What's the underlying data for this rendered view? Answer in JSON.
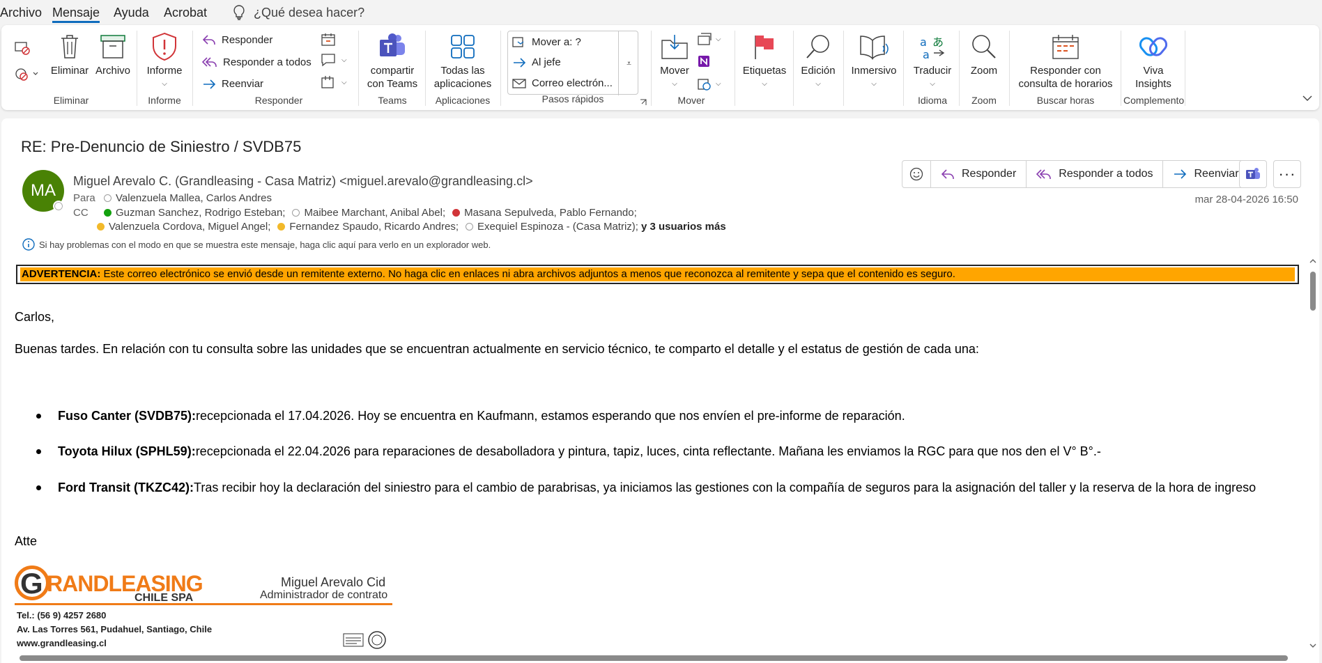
{
  "menu": {
    "tabs": [
      "Archivo",
      "Mensaje",
      "Ayuda",
      "Acrobat"
    ],
    "tell_me": "¿Qué desea hacer?"
  },
  "ribbon": {
    "eliminar": {
      "delete": "Eliminar",
      "archive": "Archivo",
      "label": "Eliminar"
    },
    "informe": {
      "button": "Informe",
      "label": "Informe"
    },
    "responder": {
      "reply": "Responder",
      "reply_all": "Responder a todos",
      "forward": "Reenviar",
      "label": "Responder"
    },
    "teams": {
      "button_1": "compartir",
      "button_2": "con Teams",
      "label": "Teams"
    },
    "apps": {
      "button_1": "Todas las",
      "button_2": "aplicaciones",
      "label": "Aplicaciones"
    },
    "quick_steps": {
      "items": [
        "Mover a: ?",
        "Al jefe",
        "Correo electrón..."
      ],
      "label": "Pasos rápidos"
    },
    "mover": {
      "button": "Mover",
      "label": "Mover"
    },
    "etiquetas": {
      "button": "Etiquetas"
    },
    "edicion": {
      "button": "Edición"
    },
    "inmersivo": {
      "button": "Inmersivo"
    },
    "idioma": {
      "button": "Traducir",
      "label": "Idioma"
    },
    "zoom": {
      "button": "Zoom",
      "label": "Zoom"
    },
    "buscar": {
      "button_1": "Responder con",
      "button_2": "consulta de horarios",
      "label": "Buscar horas"
    },
    "complemento": {
      "button_1": "Viva",
      "button_2": "Insights",
      "label": "Complemento"
    }
  },
  "message": {
    "subject": "RE: Pre-Denuncio de Siniestro / SVDB75",
    "avatar": "MA",
    "sender": "Miguel Arevalo C.  (Grandleasing - Casa Matriz) <miguel.arevalo@grandleasing.cl>",
    "to_label": "Para",
    "to": "Valenzuela Mallea, Carlos Andres",
    "cc_label": "CC",
    "cc_1": "Guzman Sanchez, Rodrigo Esteban;",
    "cc_2": "Maibee Marchant, Anibal Abel;",
    "cc_3": "Masana Sepulveda, Pablo Fernando;",
    "cc_4": "Valenzuela Cordova, Miguel Angel;",
    "cc_5": "Fernandez Spaudo, Ricardo Andres;",
    "cc_6": "Exequiel Espinoza - (Casa Matriz);",
    "cc_more": "y 3 usuarios más",
    "date": "mar 28-04-2026 16:50",
    "actions": {
      "reply": "Responder",
      "reply_all": "Responder a todos",
      "forward": "Reenviar"
    },
    "info": "Si hay problemas con el modo en que se muestra este mensaje, haga clic aquí para verlo en un explorador web."
  },
  "body": {
    "warning_bold": "ADVERTENCIA:",
    "warning_text": " Este correo electrónico se envió desde un remitente externo. No haga clic en enlaces ni abra archivos adjuntos a menos que reconozca al remitente y sepa que el contenido es seguro.",
    "greeting": "Carlos,",
    "intro": "Buenas tardes. En relación con tu consulta sobre las unidades que se encuentran actualmente en servicio técnico, te comparto el detalle y el estatus de gestión de cada una:",
    "items": [
      {
        "bold": "Fuso Canter (SVDB75):",
        "text": " recepcionada el 17.04.2026. Hoy se encuentra en Kaufmann, estamos esperando que nos envíen el pre-informe de reparación."
      },
      {
        "bold": "Toyota Hilux (SPHL59):",
        "text": " recepcionada el 22.04.2026 para reparaciones de desabolladora y pintura, tapiz, luces, cinta reflectante. Mañana les enviamos la RGC para que nos den el V° B°.-"
      },
      {
        "bold": "Ford Transit (TKZC42):",
        "text": " Tras recibir hoy la declaración del siniestro para el cambio de parabrisas, ya iniciamos las gestiones con la compañía de seguros para la asignación del taller y la reserva de la hora de ingreso"
      }
    ],
    "closing": "Atte",
    "signature": {
      "brand_1": "G",
      "brand_2": "RAND",
      "brand_3": "LEASING",
      "brand_sub": "CHILE SPA",
      "name": "Miguel Arevalo Cid",
      "role": "Administrador de contrato",
      "phone": "Tel.: (56 9) 4257 2680",
      "address": "Av. Las Torres 561, Pudahuel, Santiago, Chile",
      "web": "www.grandleasing.cl"
    }
  },
  "colors": {
    "accent": "#0f6cbd",
    "warning": "#ffa500",
    "brand_orange": "#f07b17",
    "avatar": "#498205"
  }
}
